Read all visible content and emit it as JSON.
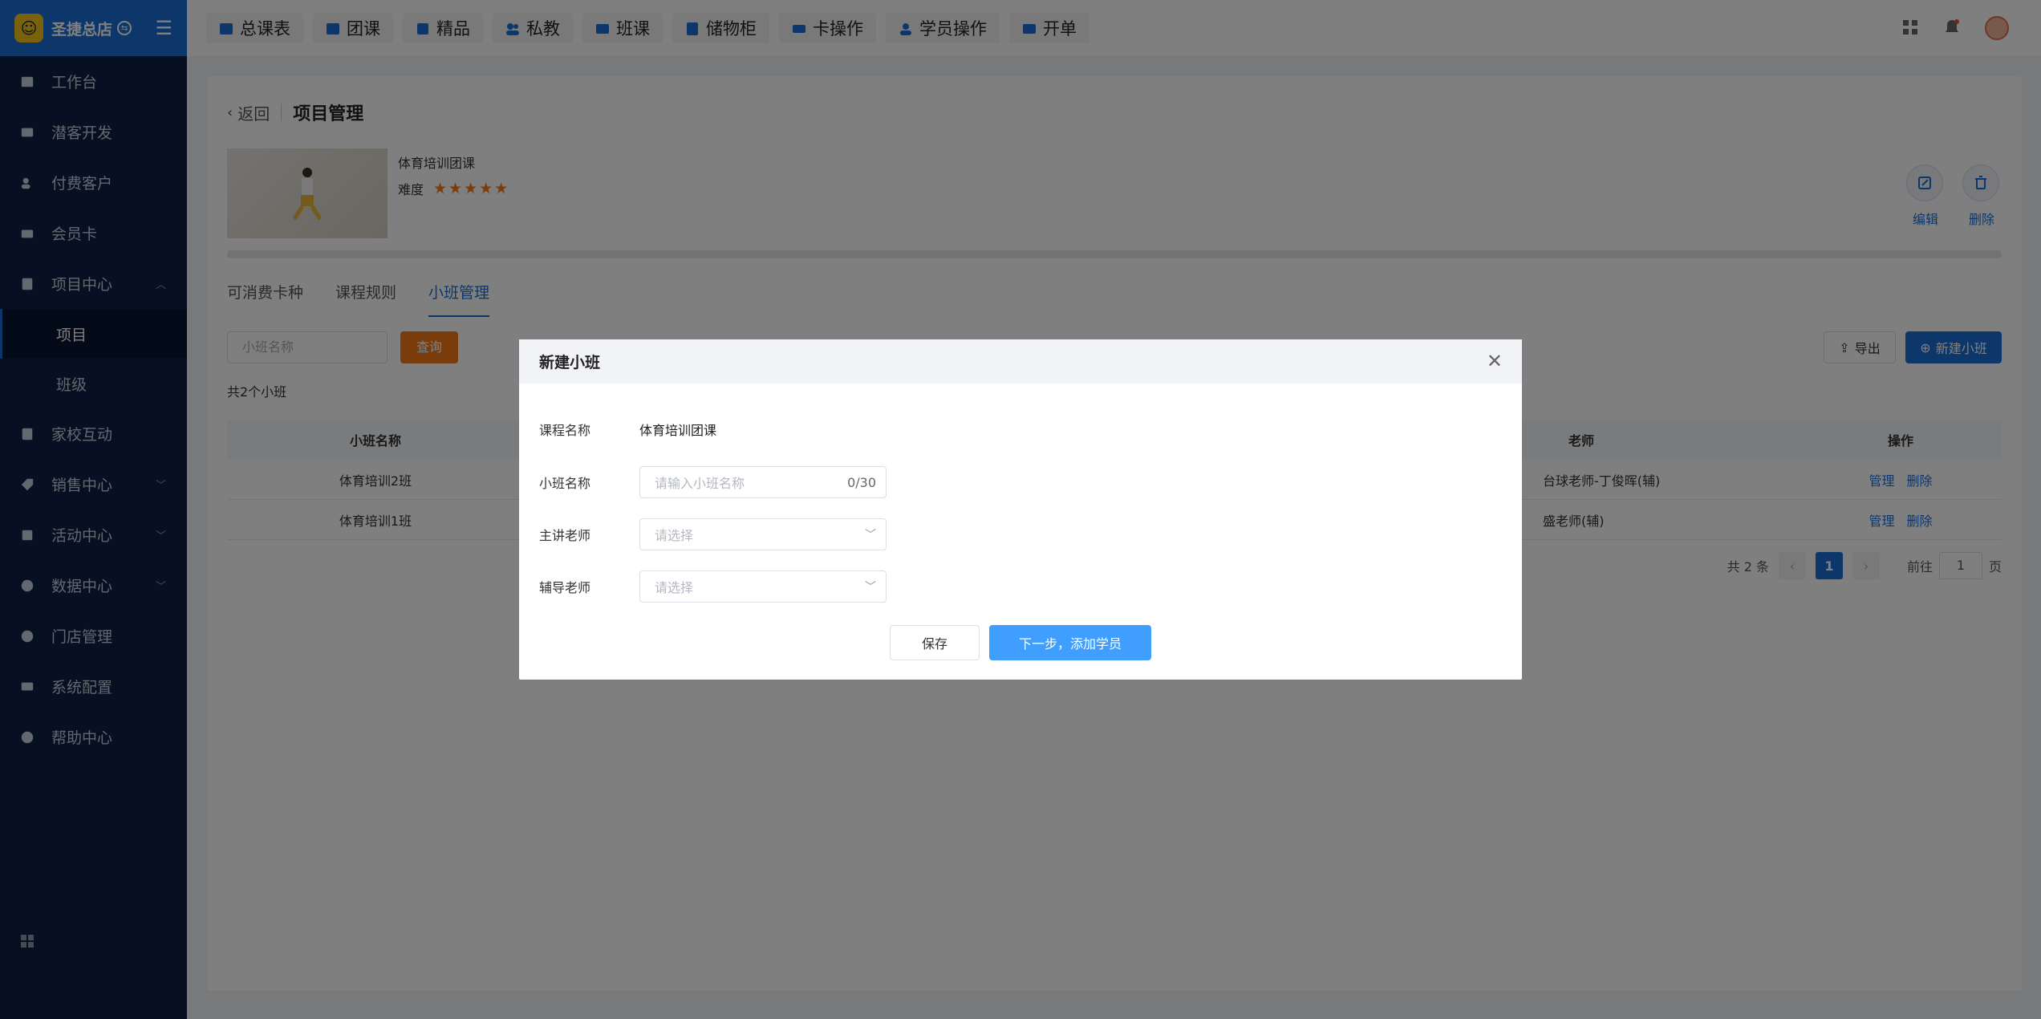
{
  "brand": {
    "name": "圣捷总店",
    "logo_icon": "logo-icon"
  },
  "sidebar": {
    "items": [
      {
        "label": "工作台",
        "icon": "image-icon"
      },
      {
        "label": "潜客开发",
        "icon": "id-card-icon"
      },
      {
        "label": "付费客户",
        "icon": "users-icon"
      },
      {
        "label": "会员卡",
        "icon": "card-icon"
      },
      {
        "label": "项目中心",
        "icon": "project-icon"
      },
      {
        "label": "家校互动",
        "icon": "contact-icon"
      },
      {
        "label": "销售中心",
        "icon": "tag-icon"
      },
      {
        "label": "活动中心",
        "icon": "activity-icon"
      },
      {
        "label": "数据中心",
        "icon": "pie-chart-icon"
      },
      {
        "label": "门店管理",
        "icon": "store-icon"
      },
      {
        "label": "系统配置",
        "icon": "settings-icon"
      },
      {
        "label": "帮助中心",
        "icon": "help-icon"
      }
    ],
    "sub_items": [
      {
        "label": "项目"
      },
      {
        "label": "班级"
      }
    ]
  },
  "topbar": {
    "tabs": [
      {
        "label": "总课表"
      },
      {
        "label": "团课"
      },
      {
        "label": "精品"
      },
      {
        "label": "私教"
      },
      {
        "label": "班课"
      },
      {
        "label": "储物柜"
      },
      {
        "label": "卡操作"
      },
      {
        "label": "学员操作"
      },
      {
        "label": "开单"
      }
    ]
  },
  "page": {
    "back_label": "返回",
    "title": "项目管理",
    "course_name": "体育培训团课",
    "difficulty_label": "难度",
    "stars": "★★★★★",
    "edit_label": "编辑",
    "delete_label": "删除",
    "sub_tabs": [
      {
        "label": "可消费卡种"
      },
      {
        "label": "课程规则"
      },
      {
        "label": "小班管理"
      }
    ],
    "search_placeholder": "小班名称",
    "query_label": "查询",
    "export_label": "导出",
    "new_label": "新建小班",
    "count_text": "共2个小班",
    "table": {
      "headers": {
        "name": "小班名称",
        "teacher": "老师",
        "action": "操作"
      },
      "rows": [
        {
          "name": "体育培训2班",
          "teacher": "台球老师-丁俊晖(辅)",
          "manage": "管理",
          "delete": "删除"
        },
        {
          "name": "体育培训1班",
          "teacher": "盛老师(辅)",
          "manage": "管理",
          "delete": "删除"
        }
      ]
    },
    "pager": {
      "total": "共 2 条",
      "current": "1",
      "goto_label": "前往",
      "page_value": "1",
      "page_unit": "页"
    }
  },
  "modal": {
    "title": "新建小班",
    "course_label": "课程名称",
    "course_value": "体育培训团课",
    "class_label": "小班名称",
    "class_placeholder": "请输入小班名称",
    "class_count": "0/30",
    "main_teacher_label": "主讲老师",
    "main_teacher_placeholder": "请选择",
    "assist_teacher_label": "辅导老师",
    "assist_teacher_placeholder": "请选择",
    "save_label": "保存",
    "next_label": "下一步，添加学员"
  }
}
